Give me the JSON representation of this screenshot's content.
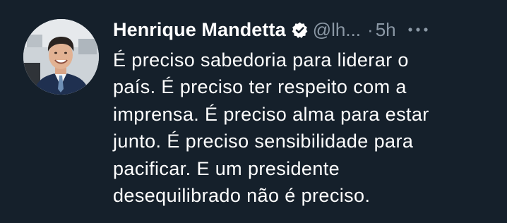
{
  "tweet": {
    "author": {
      "display_name": "Henrique Mandetta",
      "handle": "@lh...",
      "verified": true,
      "avatar_icon": "profile-photo"
    },
    "separator": "·",
    "timestamp": "5h",
    "more_icon": "more-options-icon",
    "text_lines": [
      "É preciso sabedoria para liderar o",
      "país. É preciso ter respeito com a",
      "imprensa. É preciso alma para estar",
      "junto. É preciso sensibilidade para",
      "pacificar. E um presidente",
      "desequilibrado não é preciso."
    ]
  },
  "colors": {
    "background": "#15202b",
    "primary_text": "#ffffff",
    "secondary_text": "#8b98a5",
    "verified_badge": "#ffffff"
  }
}
